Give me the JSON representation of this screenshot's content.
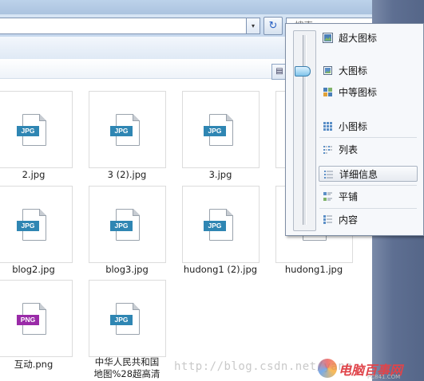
{
  "toolbar": {
    "search_placeholder": "搜索",
    "address_dropdown": "▾",
    "refresh": "↻",
    "view_toggle": "▤"
  },
  "files": [
    {
      "name": "2.jpg",
      "type": "JPG"
    },
    {
      "name": "3 (2).jpg",
      "type": "JPG"
    },
    {
      "name": "3.jpg",
      "type": "JPG"
    },
    {
      "name": "blog2.jpg",
      "type": "JPG"
    },
    {
      "name": "blog3.jpg",
      "type": "JPG"
    },
    {
      "name": "hudong1 (2).jpg",
      "type": "JPG"
    },
    {
      "name": "hudong1.jpg",
      "type": "JPG"
    },
    {
      "name": "互动.png",
      "type": "PNG"
    },
    {
      "name": "中华人民共和国",
      "name_line2": "地图%28超高清",
      "type": "JPG"
    }
  ],
  "view_menu": {
    "items": [
      {
        "label": "超大图标",
        "icon": "extra-large-icons-icon"
      },
      {
        "label": "大图标",
        "icon": "large-icons-icon"
      },
      {
        "label": "中等图标",
        "icon": "medium-icons-icon"
      },
      {
        "label": "小图标",
        "icon": "small-icons-icon"
      },
      {
        "label": "列表",
        "icon": "list-icon"
      },
      {
        "label": "详细信息",
        "icon": "details-icon",
        "selected": true
      },
      {
        "label": "平铺",
        "icon": "tiles-icon"
      },
      {
        "label": "内容",
        "icon": "content-icon"
      }
    ]
  },
  "watermark": {
    "url": "http://blog.csdn.net/yang",
    "logo": "电脑百事网",
    "logo_sub": "PC841.COM"
  },
  "colors": {
    "jpg_badge": "#2f86b3",
    "png_badge": "#9a2ba8",
    "window_frame": "#5e6f92"
  }
}
